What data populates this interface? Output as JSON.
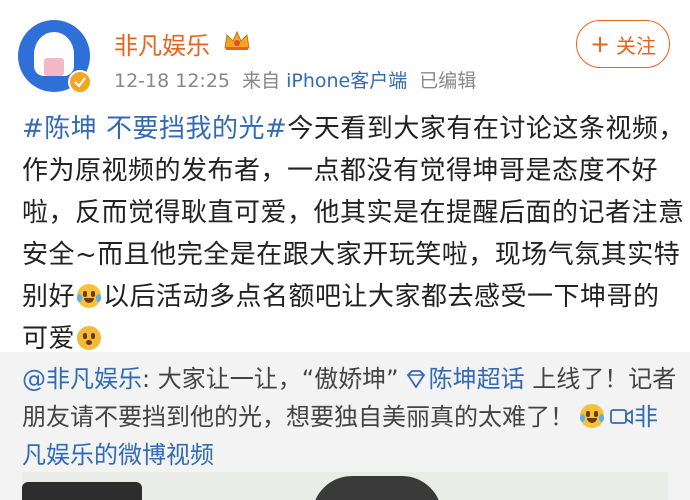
{
  "header": {
    "username": "非凡娱乐",
    "timestamp": "12-18 12:25",
    "source_prefix": "来自",
    "source_link": "iPhone客户端",
    "edited": "已编辑",
    "follow_label": "关注",
    "follow_icon": "+"
  },
  "post": {
    "hashtag": "#陈坤 不要挡我的光#",
    "line1_rest": "今天看到大家有在讨论这条视频，",
    "line2": "作为原视频的发布者，一点都没有觉得坤哥是态度不好",
    "line3": "啦，反而觉得耿直可爱，他其实是在提醒后面的记者注意",
    "line4": "安全~而且他完全是在跟大家开玩笑啦，现场气氛其实特",
    "line5_a": "别好",
    "line5_b": "以后活动多点名额吧让大家都去感受一下坤哥的",
    "line6": "可爱"
  },
  "repost": {
    "author_mention": "@非凡娱乐",
    "text_a": ": 大家让一让，“傲娇坤”",
    "super_topic": "陈坤超话",
    "text_b": " 上线了！记者",
    "line2_a": "朋友请不要挡到他的光，想要独自美丽真的太难了！",
    "video_link_a": "非",
    "line3": "凡娱乐的微博视频"
  },
  "icons": {
    "verified": "verified-badge-icon",
    "crown": "crown-icon",
    "emoji_laugh_cry": "laugh-cry-emoji-icon",
    "emoji_cute": "cute-emoji-icon",
    "super_topic": "diamond-icon",
    "video": "video-icon"
  },
  "colors": {
    "username": "#e8641b",
    "link": "#336ab5",
    "meta": "#888888",
    "repost_bg": "#f3f3f3"
  }
}
